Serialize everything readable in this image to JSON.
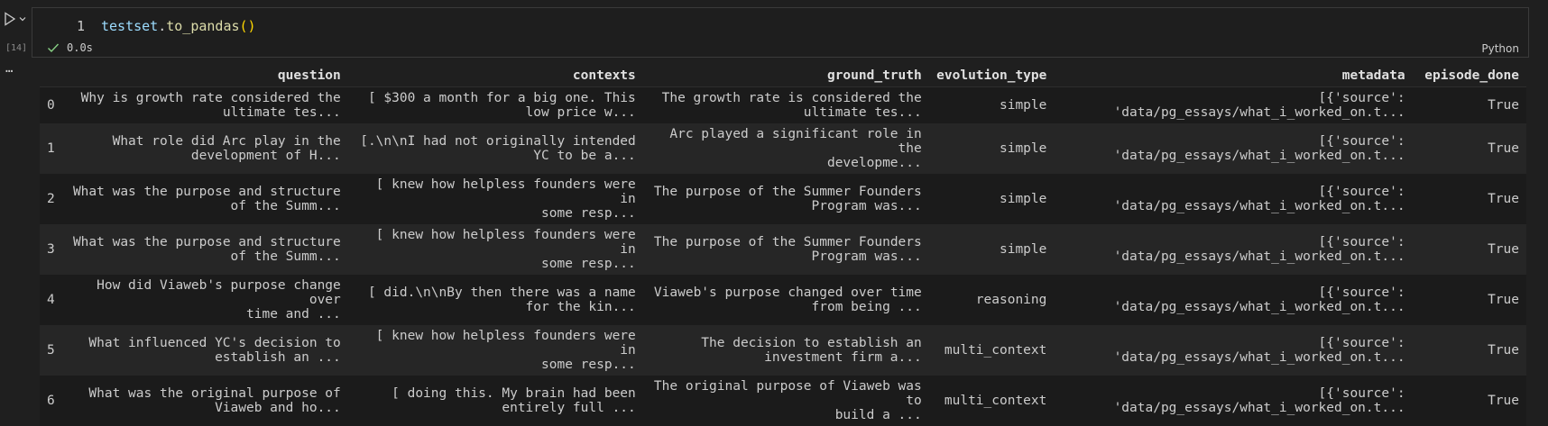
{
  "cell": {
    "execution_count": "[14]",
    "line_number": "1",
    "code": {
      "variable": "testset",
      "dot": ".",
      "method": "to_pandas",
      "parens": "()"
    },
    "status_time": "0.0s",
    "language": "Python"
  },
  "table": {
    "columns": [
      "question",
      "contexts",
      "ground_truth",
      "evolution_type",
      "metadata",
      "episode_done"
    ],
    "rows": [
      {
        "index": "0",
        "question": "Why is growth rate considered the\nultimate tes...",
        "contexts": "[ $300 a month for a big one. This\nlow price w...",
        "ground_truth": "The growth rate is considered the\nultimate tes...",
        "evolution_type": "simple",
        "metadata": "[{'source':\n'data/pg_essays/what_i_worked_on.t...",
        "episode_done": "True"
      },
      {
        "index": "1",
        "question": "What role did Arc play in the\ndevelopment of H...",
        "contexts": "[.\\n\\nI had not originally intended\nYC to be a...",
        "ground_truth": "Arc played a significant role in the\ndevelopme...",
        "evolution_type": "simple",
        "metadata": "[{'source':\n'data/pg_essays/what_i_worked_on.t...",
        "episode_done": "True"
      },
      {
        "index": "2",
        "question": "What was the purpose and structure\nof the Summ...",
        "contexts": "[ knew how helpless founders were in\nsome resp...",
        "ground_truth": "The purpose of the Summer Founders\nProgram was...",
        "evolution_type": "simple",
        "metadata": "[{'source':\n'data/pg_essays/what_i_worked_on.t...",
        "episode_done": "True"
      },
      {
        "index": "3",
        "question": "What was the purpose and structure\nof the Summ...",
        "contexts": "[ knew how helpless founders were in\nsome resp...",
        "ground_truth": "The purpose of the Summer Founders\nProgram was...",
        "evolution_type": "simple",
        "metadata": "[{'source':\n'data/pg_essays/what_i_worked_on.t...",
        "episode_done": "True"
      },
      {
        "index": "4",
        "question": "How did Viaweb's purpose change over\ntime and ...",
        "contexts": "[ did.\\n\\nBy then there was a name\nfor the kin...",
        "ground_truth": "Viaweb's purpose changed over time\nfrom being ...",
        "evolution_type": "reasoning",
        "metadata": "[{'source':\n'data/pg_essays/what_i_worked_on.t...",
        "episode_done": "True"
      },
      {
        "index": "5",
        "question": "What influenced YC's decision to\nestablish an ...",
        "contexts": "[ knew how helpless founders were in\nsome resp...",
        "ground_truth": "The decision to establish an\ninvestment firm a...",
        "evolution_type": "multi_context",
        "metadata": "[{'source':\n'data/pg_essays/what_i_worked_on.t...",
        "episode_done": "True"
      },
      {
        "index": "6",
        "question": "What was the original purpose of\nViaweb and ho...",
        "contexts": "[ doing this. My brain had been\nentirely full ...",
        "ground_truth": "The original purpose of Viaweb was to\nbuild a ...",
        "evolution_type": "multi_context",
        "metadata": "[{'source':\n'data/pg_essays/what_i_worked_on.t...",
        "episode_done": "True"
      }
    ]
  },
  "icons": {
    "run": "play-icon",
    "run_menu": "chevron-down-icon",
    "success": "check-icon",
    "more": "ellipsis-icon"
  },
  "colors": {
    "background": "#1f1f1f",
    "success": "#89d185",
    "row_alt": "#262626"
  }
}
